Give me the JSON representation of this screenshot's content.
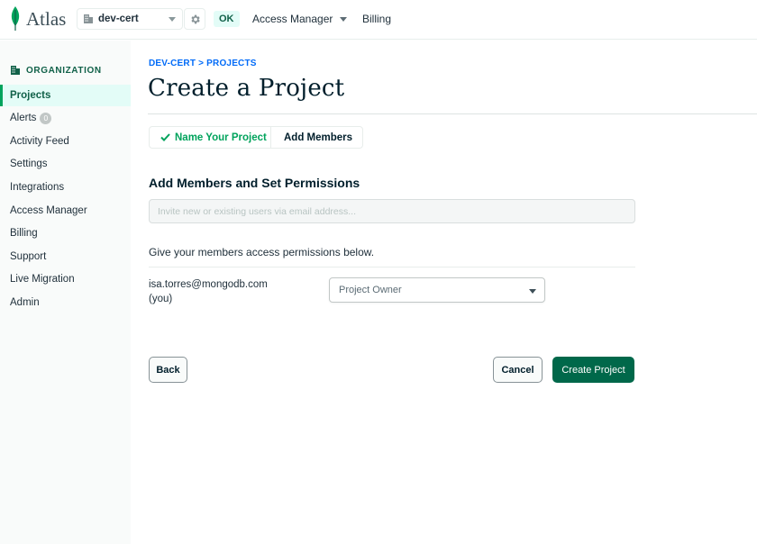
{
  "app": {
    "logo_text": "Atlas"
  },
  "topbar": {
    "org_name": "dev-cert",
    "status": "OK",
    "nav_access_manager": "Access Manager",
    "nav_billing": "Billing"
  },
  "sidebar": {
    "header": "ORGANIZATION",
    "items": [
      {
        "label": "Projects",
        "active": true
      },
      {
        "label": "Alerts",
        "badge": "0"
      },
      {
        "label": "Activity Feed"
      },
      {
        "label": "Settings"
      },
      {
        "label": "Integrations"
      },
      {
        "label": "Access Manager"
      },
      {
        "label": "Billing"
      },
      {
        "label": "Support"
      },
      {
        "label": "Live Migration"
      },
      {
        "label": "Admin"
      }
    ]
  },
  "main": {
    "breadcrumb": "DEV-CERT > PROJECTS",
    "title": "Create a Project",
    "steps": [
      {
        "label": "Name Your Project",
        "done": true
      },
      {
        "label": "Add Members",
        "current": true
      }
    ],
    "section_title": "Add Members and Set Permissions",
    "invite_placeholder": "Invite new or existing users via email address...",
    "invite_value": "",
    "permissions_text": "Give your members access permissions below.",
    "member": {
      "email": "isa.torres@mongodb.com",
      "note": "(you)",
      "role": "Project Owner"
    },
    "buttons": {
      "back": "Back",
      "cancel": "Cancel",
      "create": "Create Project"
    }
  },
  "colors": {
    "brand_green": "#00684a",
    "accent_green": "#00a35c",
    "link_blue": "#016bf8",
    "sidebar_bg": "#f9fbfa",
    "active_bg": "#e3fcf7"
  }
}
